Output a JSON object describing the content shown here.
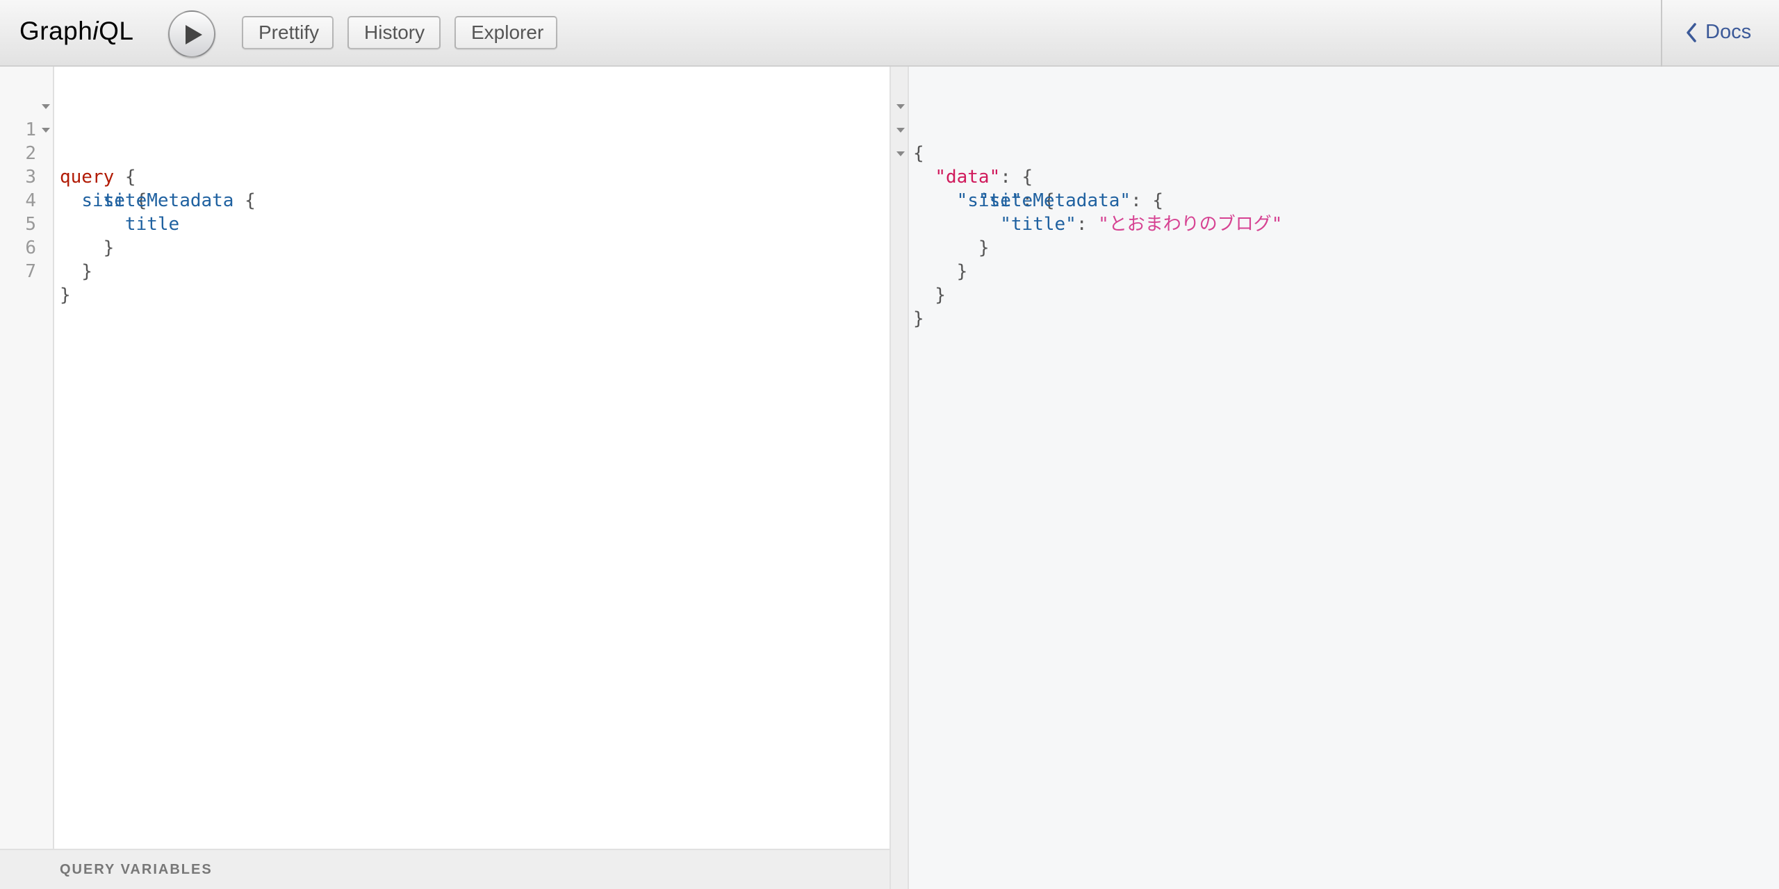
{
  "toolbar": {
    "logo_prefix": "Graph",
    "logo_italic": "i",
    "logo_suffix": "QL",
    "prettify_label": "Prettify",
    "history_label": "History",
    "explorer_label": "Explorer",
    "docs_label": "Docs"
  },
  "query_editor": {
    "line_numbers": [
      "1",
      "2",
      "3",
      "4",
      "5",
      "6",
      "7"
    ],
    "tokens": {
      "l1_kw": "query",
      "l1_brace": " {",
      "l2_indent": "  ",
      "l2_field": "site",
      "l2_brace": " {",
      "l3_indent": "    ",
      "l3_field": "siteMetadata",
      "l3_brace": " {",
      "l4_indent": "      ",
      "l4_field": "title",
      "l5": "    }",
      "l6": "  }",
      "l7": "}"
    }
  },
  "query_variables": {
    "title": "QUERY VARIABLES"
  },
  "result": {
    "l1": "{",
    "l2_indent": "  ",
    "l2_key": "\"data\"",
    "l2_rest": ": {",
    "l3_indent": "    ",
    "l3_key": "\"site\"",
    "l3_rest": ": {",
    "l4_indent": "      ",
    "l4_key": "\"siteMetadata\"",
    "l4_rest": ": {",
    "l5_indent": "        ",
    "l5_key": "\"title\"",
    "l5_sep": ": ",
    "l5_value": "\"とおまわりのブログ\"",
    "l6": "      }",
    "l7": "    }",
    "l8": "  }",
    "l9": "}"
  },
  "colors": {
    "keyword": "#b11a04",
    "field": "#1f61a0",
    "json_root_key": "#d01a5c",
    "json_string": "#d64292",
    "docs_link": "#3b5998"
  }
}
